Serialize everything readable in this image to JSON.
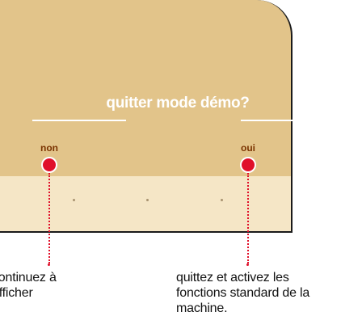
{
  "dialog": {
    "title": "quitter mode démo?",
    "options": {
      "non_label": "non",
      "oui_label": "oui"
    }
  },
  "callouts": {
    "non_text": "continuez à\nafficher",
    "oui_text": "quittez et activez les\nfonctions standard de la\nmachine."
  },
  "colors": {
    "panel": "#e2c48a",
    "panel_lower": "#f5e6c6",
    "option_dot": "#e0102a",
    "option_label": "#7a3300",
    "title_text": "#ffffff"
  }
}
